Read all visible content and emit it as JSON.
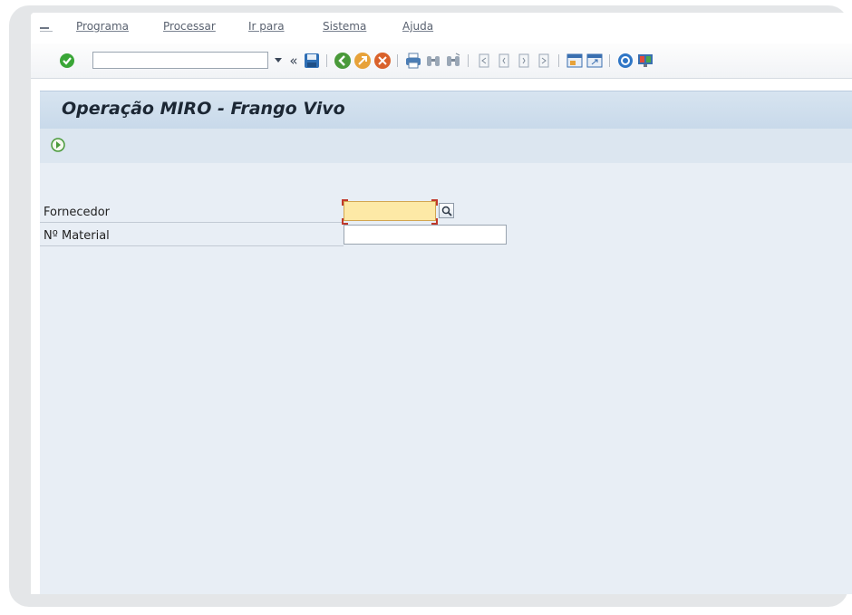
{
  "menu": {
    "items": [
      "Programa",
      "Processar",
      "Ir para",
      "Sistema",
      "Ajuda"
    ]
  },
  "toolbar": {
    "command_value": "",
    "back_chevron": "«"
  },
  "screen": {
    "title": "Operação MIRO - Frango Vivo"
  },
  "form": {
    "fields": [
      {
        "label": "Fornecedor",
        "value": ""
      },
      {
        "label": "Nº Material",
        "value": ""
      }
    ]
  },
  "colors": {
    "title_band": "#c8d9ea",
    "content_bg": "#e8eef5",
    "required_field": "#fde9a6",
    "ok_green": "#3aa637"
  }
}
